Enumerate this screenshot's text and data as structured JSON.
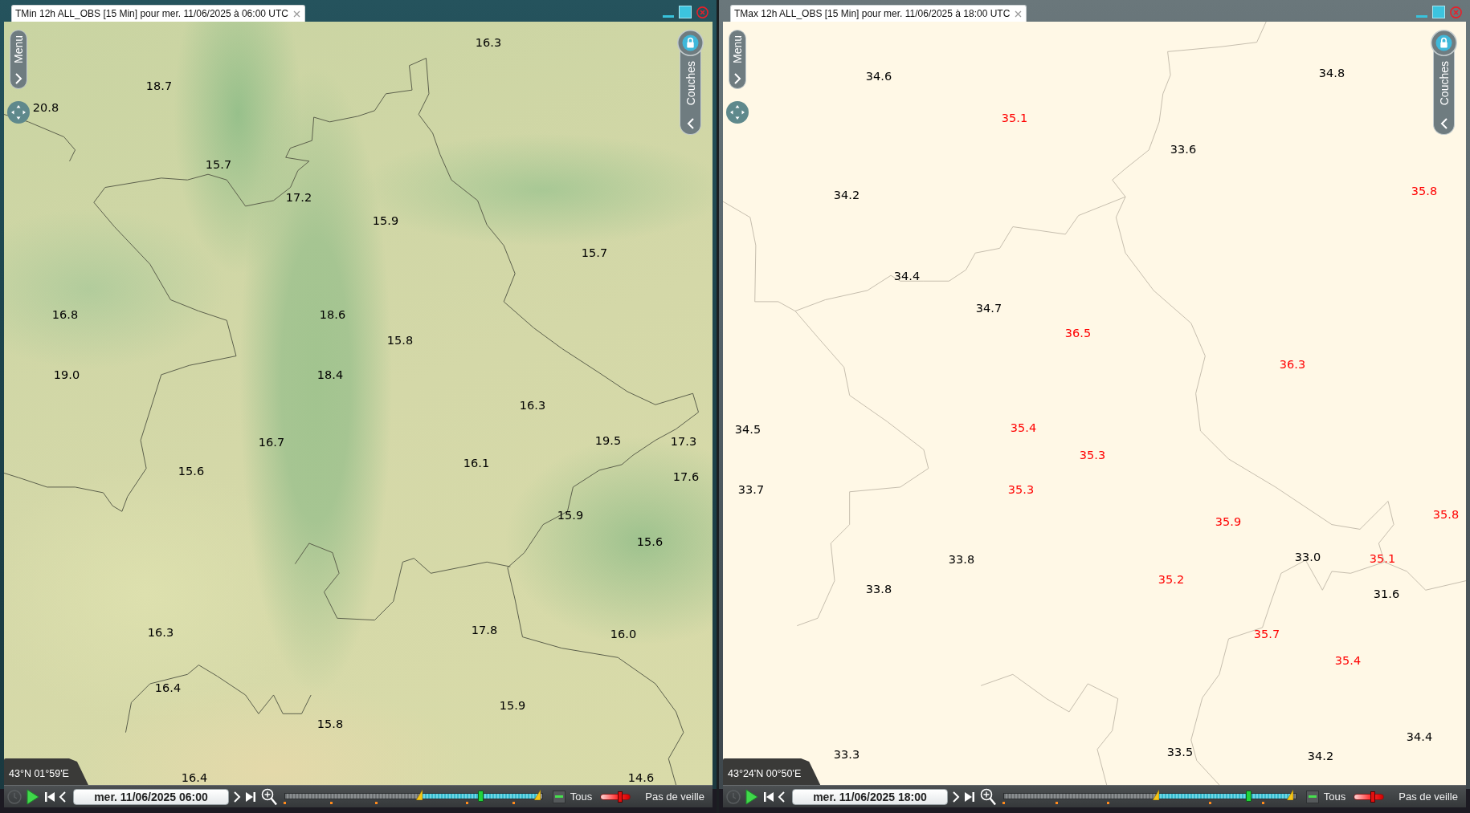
{
  "windows": [
    {
      "title": "TMin 12h ALL_OBS [15 Min] pour mer. 11/06/2025 à 06:00 UTC",
      "active": true,
      "kind": "terrain",
      "menu": "Menu",
      "layers": "Couches",
      "labels": [
        {
          "value": "16.3"
        },
        {
          "value": "18.7"
        },
        {
          "value": "20.8"
        },
        {
          "value": "15.7"
        },
        {
          "value": "17.2"
        },
        {
          "value": "15.9"
        },
        {
          "value": "15.7"
        },
        {
          "value": "16.8"
        },
        {
          "value": "18.6"
        },
        {
          "value": "15.8"
        },
        {
          "value": "19.0"
        },
        {
          "value": "18.4"
        },
        {
          "value": "16.3"
        },
        {
          "value": "16.7"
        },
        {
          "value": "19.5"
        },
        {
          "value": "17.3"
        },
        {
          "value": "15.6"
        },
        {
          "value": "16.1"
        },
        {
          "value": "17.6"
        },
        {
          "value": "15.9"
        },
        {
          "value": "15.6"
        },
        {
          "value": "16.3"
        },
        {
          "value": "17.8"
        },
        {
          "value": "16.0"
        },
        {
          "value": "16.4"
        },
        {
          "value": "15.9"
        },
        {
          "value": "15.8"
        },
        {
          "value": "16.4"
        },
        {
          "value": "14.6"
        }
      ],
      "coordinates": "43°N 01°59'E",
      "toolbar": {
        "date": "mer. 11/06/2025 06:00",
        "timeline": {
          "level": 0.76
        },
        "filter": "Tous",
        "opacity": {
          "level": 0.65
        },
        "status": "Pas de veille"
      }
    },
    {
      "title": "TMax 12h ALL_OBS [15 Min] pour mer. 11/06/2025 à 18:00 UTC",
      "active": false,
      "kind": "plain",
      "menu": "Menu",
      "layers": "Couches",
      "labels": [
        {
          "value": "34.6",
          "color": "#000000"
        },
        {
          "value": "34.8",
          "color": "#000000"
        },
        {
          "value": "35.1",
          "color": "#ff0000"
        },
        {
          "value": "33.6",
          "color": "#000000"
        },
        {
          "value": "34.2",
          "color": "#000000"
        },
        {
          "value": "35.8",
          "color": "#ff0000"
        },
        {
          "value": "34.4",
          "color": "#000000"
        },
        {
          "value": "34.7",
          "color": "#000000"
        },
        {
          "value": "36.5",
          "color": "#ff0000"
        },
        {
          "value": "36.3",
          "color": "#ff0000"
        },
        {
          "value": "34.5",
          "color": "#000000"
        },
        {
          "value": "35.4",
          "color": "#ff0000"
        },
        {
          "value": "35.3",
          "color": "#ff0000"
        },
        {
          "value": "33.7",
          "color": "#000000"
        },
        {
          "value": "35.3",
          "color": "#ff0000"
        },
        {
          "value": "35.9",
          "color": "#ff0000"
        },
        {
          "value": "35.8",
          "color": "#ff0000"
        },
        {
          "value": "33.8",
          "color": "#000000"
        },
        {
          "value": "33.0",
          "color": "#000000"
        },
        {
          "value": "35.1",
          "color": "#ff0000"
        },
        {
          "value": "33.8",
          "color": "#000000"
        },
        {
          "value": "35.2",
          "color": "#ff0000"
        },
        {
          "value": "31.6",
          "color": "#000000"
        },
        {
          "value": "35.7",
          "color": "#ff0000"
        },
        {
          "value": "35.4",
          "color": "#ff0000"
        },
        {
          "value": "34.4",
          "color": "#000000"
        },
        {
          "value": "33.3",
          "color": "#000000"
        },
        {
          "value": "33.5",
          "color": "#000000"
        },
        {
          "value": "34.2",
          "color": "#000000"
        }
      ],
      "coordinates": "43°24'N 00°50'E",
      "toolbar": {
        "date": "mer. 11/06/2025 18:00",
        "timeline": {
          "level": 0.84
        },
        "filter": "Tous",
        "opacity": {
          "level": 0.62
        },
        "status": "Pas de veille"
      }
    }
  ]
}
